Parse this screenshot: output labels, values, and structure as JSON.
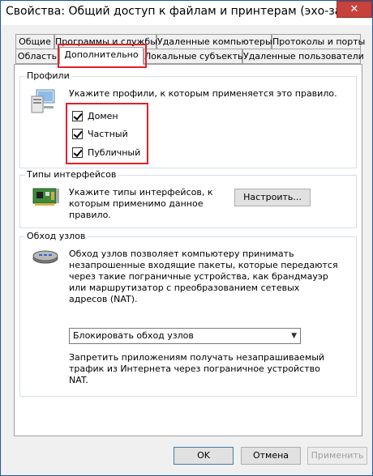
{
  "window": {
    "title": "Свойства: Общий доступ к файлам и принтерам (эхо-запр...",
    "close_glyph": "✕"
  },
  "tabs_row1": [
    "Общие",
    "Программы и службы",
    "Удаленные компьютеры",
    "Протоколы и порты"
  ],
  "tabs_row2": [
    "Область",
    "Дополнительно",
    "Локальные субъекты",
    "Удаленные пользователи"
  ],
  "active_tab": "Дополнительно",
  "profiles": {
    "title": "Профили",
    "description": "Укажите профили, к которым применяется это правило.",
    "items": [
      {
        "label": "Домен",
        "checked": true
      },
      {
        "label": "Частный",
        "checked": true
      },
      {
        "label": "Публичный",
        "checked": true
      }
    ],
    "icon": "profiles-computer-icon"
  },
  "interfaces": {
    "title": "Типы интерфейсов",
    "description_lines": [
      "Укажите типы интерфейсов, к",
      "которым применимо данное",
      "правило."
    ],
    "configure_label": "Настроить...",
    "icon": "network-card-icon"
  },
  "traversal": {
    "title": "Обход узлов",
    "description_lines": [
      "Обход узлов позволяет компьютеру принимать",
      "незапрошенные входящие пакеты, которые передаются",
      "через такие пограничные устройства, как брандмауэр",
      "или маршрутизатор с преобразованием сетевых",
      "адресов (NAT)."
    ],
    "select_value": "Блокировать обход узлов",
    "note_lines": [
      "Запретить приложениям получать незапрашиваемый",
      "трафик из Интернета через пограничное устройство",
      "NAT."
    ],
    "icon": "router-icon"
  },
  "footer": {
    "ok_label": "OK",
    "cancel_label": "Отмена",
    "apply_label": "Применить"
  },
  "colors": {
    "highlight": "#e0202a",
    "close": "#c7423a",
    "accent": "#3c7fb1"
  }
}
